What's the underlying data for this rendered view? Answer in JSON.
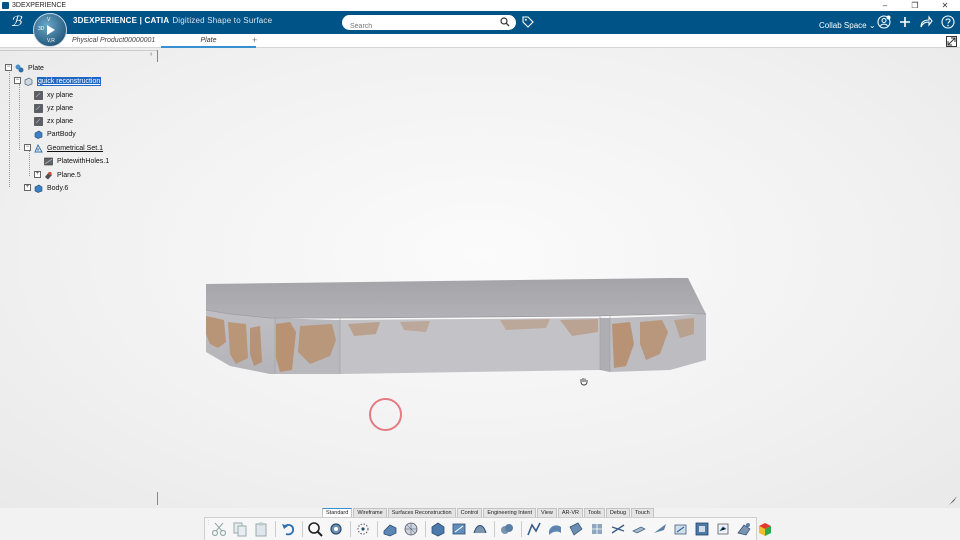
{
  "window": {
    "title": "3DEXPERIENCE",
    "controls": [
      "–",
      "❐",
      "✕"
    ]
  },
  "topbar": {
    "brand_bold": "3DEXPERIENCE | CATIA",
    "brand_app": "Digitized Shape to Surface",
    "search_placeholder": "Search",
    "collab_space": "Collab Space",
    "compass_label": "3D",
    "compass_version": "V,R",
    "compass_v": "V"
  },
  "tabs": {
    "items": [
      "Physical Product00000001",
      "Plate"
    ],
    "active": "Plate",
    "add": "+"
  },
  "tree": {
    "nodes": [
      {
        "label": "Plate",
        "icon": "product-icon",
        "expander": "−",
        "style": ""
      },
      {
        "label": "quick reconstruction",
        "icon": "part-icon",
        "expander": "−",
        "style": "sel"
      },
      {
        "label": "xy plane",
        "icon": "plane-icon",
        "expander": "",
        "style": ""
      },
      {
        "label": "yz plane",
        "icon": "plane-icon",
        "expander": "",
        "style": ""
      },
      {
        "label": "zx plane",
        "icon": "plane-icon",
        "expander": "",
        "style": ""
      },
      {
        "label": "PartBody",
        "icon": "body-icon",
        "expander": "",
        "style": ""
      },
      {
        "label": "Geometrical Set.1",
        "icon": "geometrical-set-icon",
        "expander": "−",
        "style": "und"
      },
      {
        "label": "PlatewithHoles.1",
        "icon": "mesh-icon",
        "expander": "",
        "style": ""
      },
      {
        "label": "Plane.5",
        "icon": "plane-feature-icon",
        "expander": "+",
        "style": ""
      },
      {
        "label": "Body.6",
        "icon": "body-icon",
        "expander": "+",
        "style": ""
      }
    ],
    "collapse_handle": "‹"
  },
  "workbench_tabs": {
    "items": [
      "Standard",
      "Wireframe",
      "Surfaces Reconstruction",
      "Control",
      "Engineering Intent",
      "View",
      "AR-VR",
      "Tools",
      "Debug",
      "Touch"
    ],
    "active": "Standard"
  },
  "action_bar": {
    "icons": [
      "cut-icon",
      "copy-icon",
      "paste-icon",
      "undo-icon",
      "zoom-fit-icon",
      "settings-gear-icon",
      "point-icon",
      "mesh-cleaner-icon",
      "sphere-mesh-icon",
      "align-icon",
      "mesh-offset-icon",
      "curve-icon",
      "cloud-icon",
      "segmentation-icon",
      "scan-icon",
      "surface-icon",
      "patch-icon",
      "network-icon",
      "sketch-icon",
      "blade-icon",
      "trim-icon",
      "frame-icon",
      "analysis-icon",
      "deviation-icon",
      "color-map-icon"
    ]
  },
  "colors": {
    "brand_bar": "#005386",
    "selection": "#2166c2",
    "tab_accent": "#3a8fd0",
    "model_gray": "#a9a9ae",
    "model_copper": "#b78e6a",
    "cursor_ring": "#e57a82"
  }
}
